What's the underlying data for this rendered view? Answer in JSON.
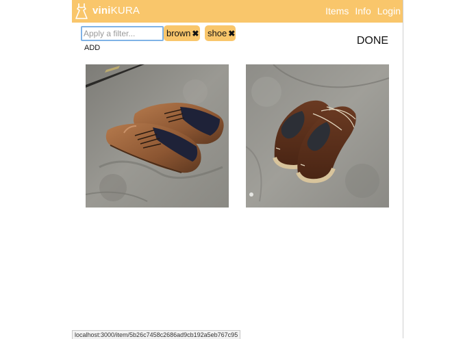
{
  "app": {
    "brand_bold": "vini",
    "brand_light": "KURA",
    "nav": [
      "Items",
      "Info",
      "Login"
    ]
  },
  "filter": {
    "placeholder": "Apply a filter...",
    "value": "",
    "add_label": "ADD",
    "tags": [
      {
        "label": "brown",
        "remove_icon": "close-icon"
      },
      {
        "label": "shoe",
        "remove_icon": "close-icon"
      }
    ]
  },
  "done_label": "DONE",
  "photos": [
    {
      "subject": "pair of tan brown leather oxford shoes on concrete floor"
    },
    {
      "subject": "pair of dark brown leather shoes with crepe soles on concrete floor"
    }
  ],
  "status_url": "localhost:3000/item/5b26c7458c2686ad9cb192a5eb767c95",
  "colors": {
    "accent": "#f9c66b",
    "focus_border": "#7fb2e6"
  }
}
